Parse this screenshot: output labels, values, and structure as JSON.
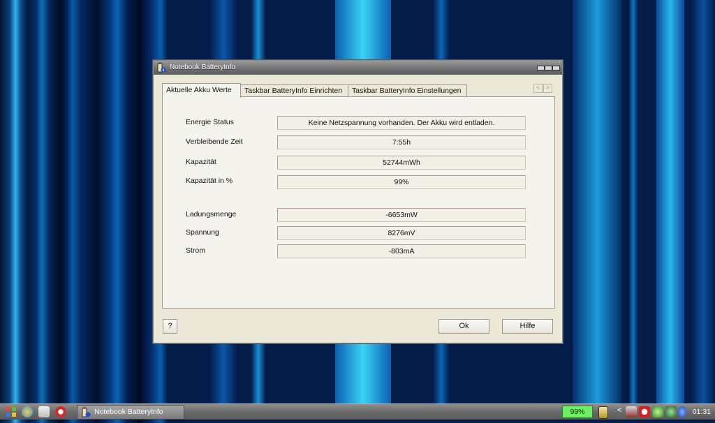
{
  "window": {
    "title": "Notebook BatteryInfo",
    "tabs": [
      {
        "label": "Aktuelle Akku Werte",
        "active": true
      },
      {
        "label": "Taskbar BatteryInfo Einrichten",
        "active": false
      },
      {
        "label": "Taskbar BatteryInfo Einstellungen",
        "active": false
      }
    ],
    "fields": [
      {
        "label": "Energie Status",
        "value": "Keine Netzspannung vorhanden. Der Akku wird entladen."
      },
      {
        "label": "Verbleibende Zeit",
        "value": "7:55h"
      },
      {
        "label": "Kapazität",
        "value": "52744mWh"
      },
      {
        "label": "Kapazität in %",
        "value": "99%"
      },
      {
        "label": "Ladungsmenge",
        "value": "-6653mW"
      },
      {
        "label": "Spannung",
        "value": "8276mV"
      },
      {
        "label": "Strom",
        "value": "-803mA"
      }
    ],
    "buttons": {
      "help_question": "?",
      "ok": "Ok",
      "help": "Hilfe"
    },
    "tab_scroll": {
      "left": "<",
      "right": ">"
    }
  },
  "taskbar": {
    "task_label": "Notebook BatteryInfo",
    "battery_percent": "99%",
    "tray_arrow": "<",
    "clock": "01:31"
  },
  "icons": [
    "start-menu-icon",
    "browser-icon",
    "drive-icon",
    "media-icon",
    "battery-app-icon",
    "battery-tray-icon",
    "network-icon",
    "antivirus-icon",
    "volume-icon",
    "bluetooth-icon",
    "window-minimize-icon",
    "window-maximize-icon",
    "window-close-icon"
  ],
  "colors": {
    "battery_fill": "#6ef065",
    "window_bg": "#ece9d8"
  }
}
